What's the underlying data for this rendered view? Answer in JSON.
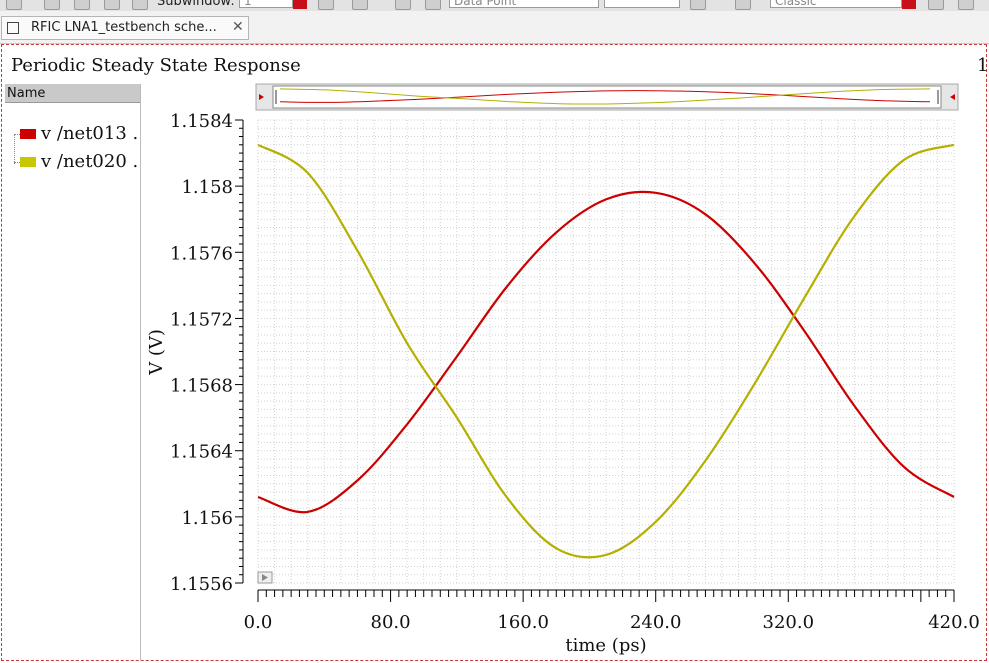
{
  "toolbar": {
    "subwindow_label": "Subwindow:",
    "subwindow_value": "1",
    "marker_value": "Data Point",
    "style_value": "Classic"
  },
  "tab": {
    "label": "RFIC LNA1_testbench sche..."
  },
  "page": {
    "title": "Periodic Steady State Response",
    "number": "1"
  },
  "legend": {
    "header": "Name",
    "items": [
      {
        "label": "v /net013 .",
        "color": "#cc0000"
      },
      {
        "label": "v /net020 .",
        "color": "#c8c800"
      }
    ]
  },
  "chart_data": {
    "type": "line",
    "title": "Periodic Steady State Response",
    "xlabel": "time (ps)",
    "ylabel": "V (V)",
    "xlim": [
      0,
      420
    ],
    "ylim": [
      1.1556,
      1.1584
    ],
    "x_ticks": [
      0,
      80,
      160,
      240,
      320,
      420
    ],
    "x_tick_labels": [
      "0.0",
      "80.0",
      "160.0",
      "240.0",
      "320.0",
      "420.0"
    ],
    "y_ticks": [
      1.1556,
      1.156,
      1.1564,
      1.1568,
      1.1572,
      1.1576,
      1.158,
      1.1584
    ],
    "y_tick_labels": [
      "1.1556",
      "1.156",
      "1.1564",
      "1.1568",
      "1.1572",
      "1.1576",
      "1.158",
      "1.1584"
    ],
    "grid": true,
    "series": [
      {
        "name": "v /net013 .",
        "color": "#cc0000",
        "x": [
          0,
          30,
          60,
          90,
          120,
          150,
          180,
          210,
          240,
          270,
          300,
          330,
          360,
          390,
          420
        ],
        "y": [
          1.15612,
          1.15603,
          1.15622,
          1.15656,
          1.15697,
          1.15739,
          1.15772,
          1.15792,
          1.15796,
          1.15783,
          1.15753,
          1.15712,
          1.15667,
          1.1563,
          1.15612
        ]
      },
      {
        "name": "v /net020 .",
        "color": "#b5b000",
        "x": [
          0,
          30,
          60,
          90,
          120,
          150,
          180,
          210,
          240,
          270,
          300,
          330,
          360,
          390,
          420
        ],
        "y": [
          1.15825,
          1.15808,
          1.15761,
          1.15705,
          1.1566,
          1.15612,
          1.15581,
          1.15577,
          1.15597,
          1.15634,
          1.15681,
          1.15733,
          1.15782,
          1.15816,
          1.15825
        ]
      }
    ]
  }
}
